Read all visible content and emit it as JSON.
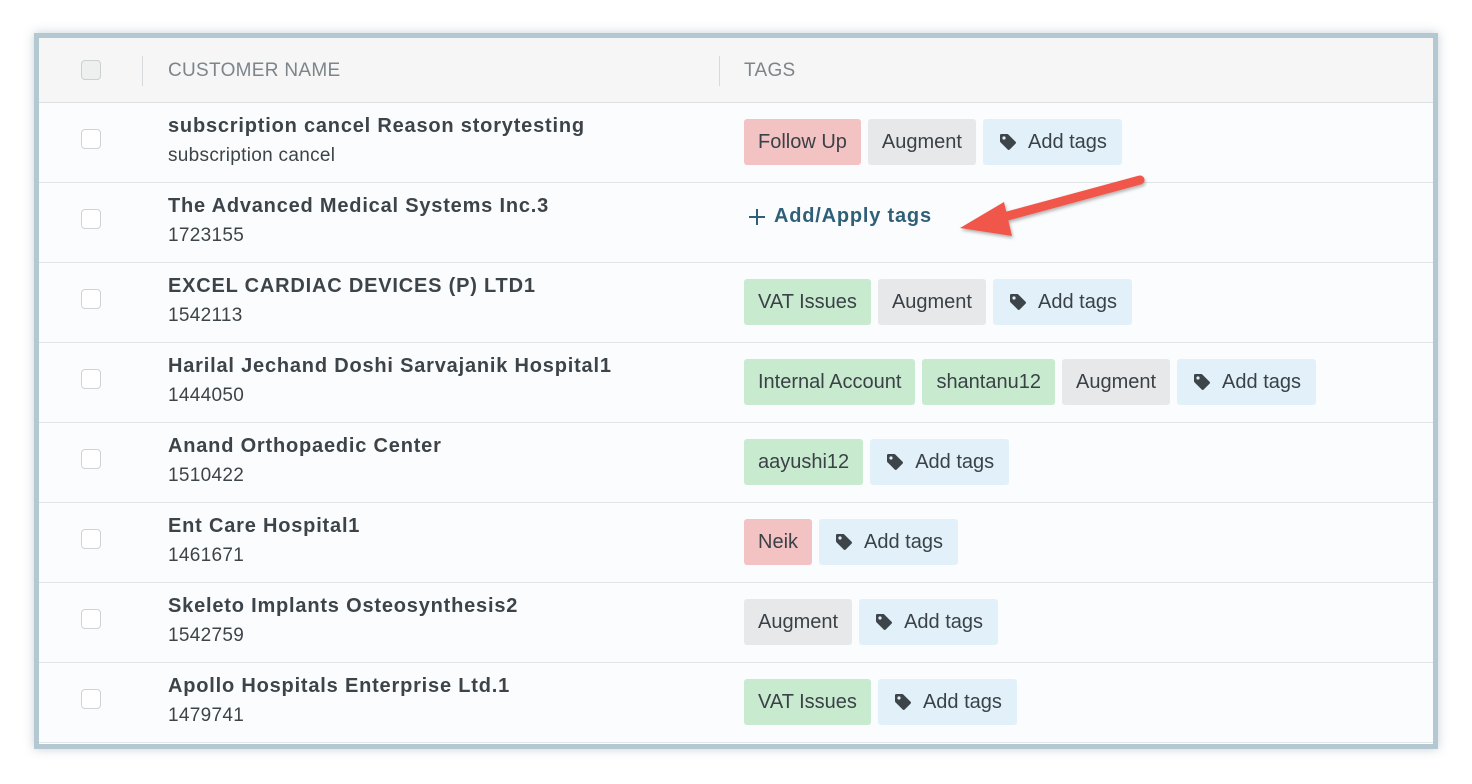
{
  "header": {
    "customer_name": "CUSTOMER NAME",
    "tags": "TAGS"
  },
  "add_tags_label": "Add tags",
  "add_apply_label": "Add/Apply tags",
  "tag_colors": {
    "red": "#f3c2c3",
    "green": "#c8ebcf",
    "gray": "#e7e8e9",
    "add": "#e2f1f9"
  },
  "rows": [
    {
      "name": "subscription cancel Reason storytesting",
      "sub": "subscription cancel",
      "tags": [
        {
          "label": "Follow Up",
          "color": "red"
        },
        {
          "label": "Augment",
          "color": "gray"
        }
      ]
    },
    {
      "name": "The Advanced Medical Systems Inc.3",
      "sub": "1723155",
      "tags": []
    },
    {
      "name": "EXCEL CARDIAC DEVICES (P) LTD1",
      "sub": "1542113",
      "tags": [
        {
          "label": "VAT Issues",
          "color": "green"
        },
        {
          "label": "Augment",
          "color": "gray"
        }
      ]
    },
    {
      "name": "Harilal Jechand Doshi Sarvajanik Hospital1",
      "sub": "1444050",
      "tags": [
        {
          "label": "Internal Account",
          "color": "green"
        },
        {
          "label": "shantanu12",
          "color": "green"
        },
        {
          "label": "Augment",
          "color": "gray"
        }
      ]
    },
    {
      "name": "Anand Orthopaedic Center",
      "sub": "1510422",
      "tags": [
        {
          "label": "aayushi12",
          "color": "green"
        }
      ]
    },
    {
      "name": "Ent Care Hospital1",
      "sub": "1461671",
      "tags": [
        {
          "label": "Neik",
          "color": "red"
        }
      ]
    },
    {
      "name": "Skeleto Implants Osteosynthesis2",
      "sub": "1542759",
      "tags": [
        {
          "label": "Augment",
          "color": "gray"
        }
      ]
    },
    {
      "name": "Apollo Hospitals Enterprise Ltd.1",
      "sub": "1479741",
      "tags": [
        {
          "label": "VAT Issues",
          "color": "green"
        }
      ]
    }
  ],
  "annotation_arrow_color": "#f0564a"
}
